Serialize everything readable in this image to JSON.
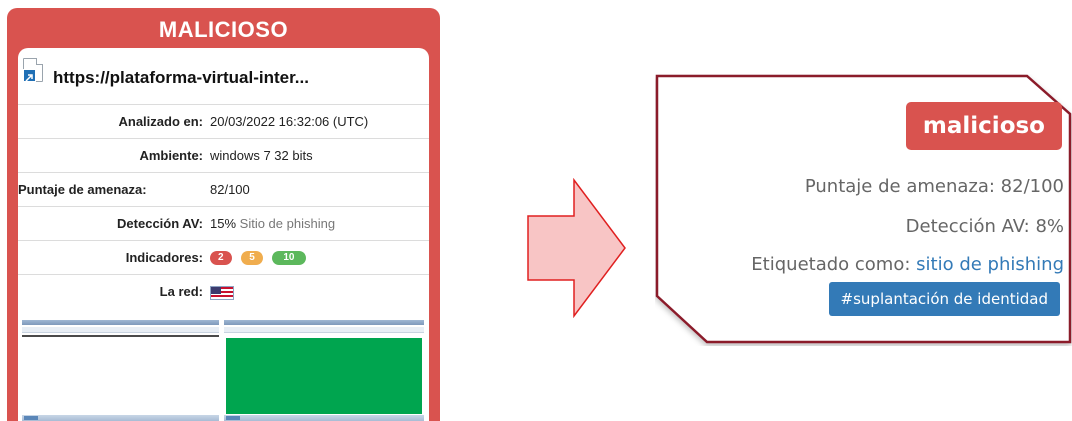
{
  "left_card": {
    "title": "MALICIOSO",
    "url": "https://plataforma-virtual-inter...",
    "rows": [
      {
        "label": "Analizado en:",
        "value": "20/03/2022 16:32:06 (UTC)"
      },
      {
        "label": "Ambiente:",
        "value": "windows 7 32 bits"
      },
      {
        "label": "Puntaje de amenaza:",
        "value": "82/100"
      },
      {
        "label": "Detección AV:",
        "value": "15%",
        "value_note": "Sitio de phishing"
      },
      {
        "label": "Indicadores:",
        "badges": [
          "2",
          "5",
          "10"
        ]
      },
      {
        "label": "La red:",
        "flag": "us-flag-icon"
      }
    ]
  },
  "right_panel": {
    "badge": "malicioso",
    "threat_score": "Puntaje de amenaza: 82/100",
    "av_detection": "Detección AV: 8%",
    "tagged_label": "Etiquetado como:",
    "tagged_link": "sitio de phishing",
    "tag_button": "#suplantación de identidad"
  },
  "colors": {
    "danger": "#d9534f",
    "warning": "#f0ad4e",
    "success": "#5cb85c",
    "primary": "#337ab7",
    "arrow_fill": "#f8c5c5",
    "arrow_stroke": "#e02020",
    "panel_border": "#8b1a2b"
  }
}
